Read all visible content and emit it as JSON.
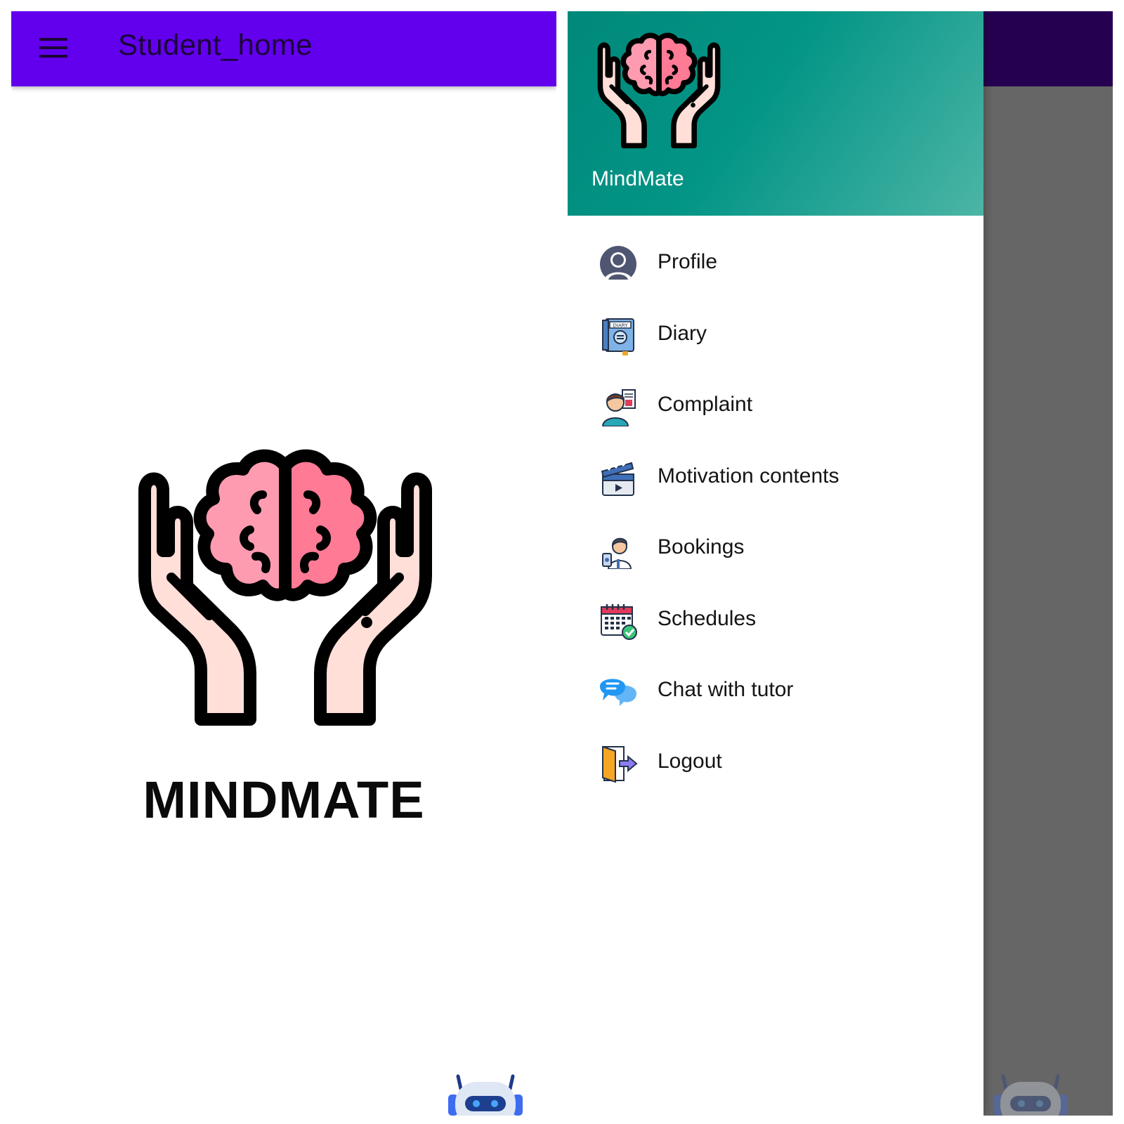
{
  "student_home": {
    "app_bar": {
      "title": "Student_home",
      "icon": "menu-icon"
    },
    "brand_title": "MINDMATE",
    "colors": {
      "app_bar": "#6200ee",
      "title_text": "#1b0538"
    }
  },
  "drawer": {
    "header_title": "MindMate",
    "colors": {
      "header_start": "#00897b",
      "header_end": "#4cb5a6",
      "scrim": "#666666"
    },
    "items": [
      {
        "label": "Profile",
        "icon": "profile-icon"
      },
      {
        "label": "Diary",
        "icon": "diary-icon"
      },
      {
        "label": "Complaint",
        "icon": "complaint-icon"
      },
      {
        "label": "Motivation contents",
        "icon": "clapperboard-icon"
      },
      {
        "label": "Bookings",
        "icon": "doctor-icon"
      },
      {
        "label": "Schedules",
        "icon": "calendar-icon"
      },
      {
        "label": "Chat with tutor",
        "icon": "chat-bubbles-icon"
      },
      {
        "label": "Logout",
        "icon": "logout-door-icon"
      }
    ]
  }
}
